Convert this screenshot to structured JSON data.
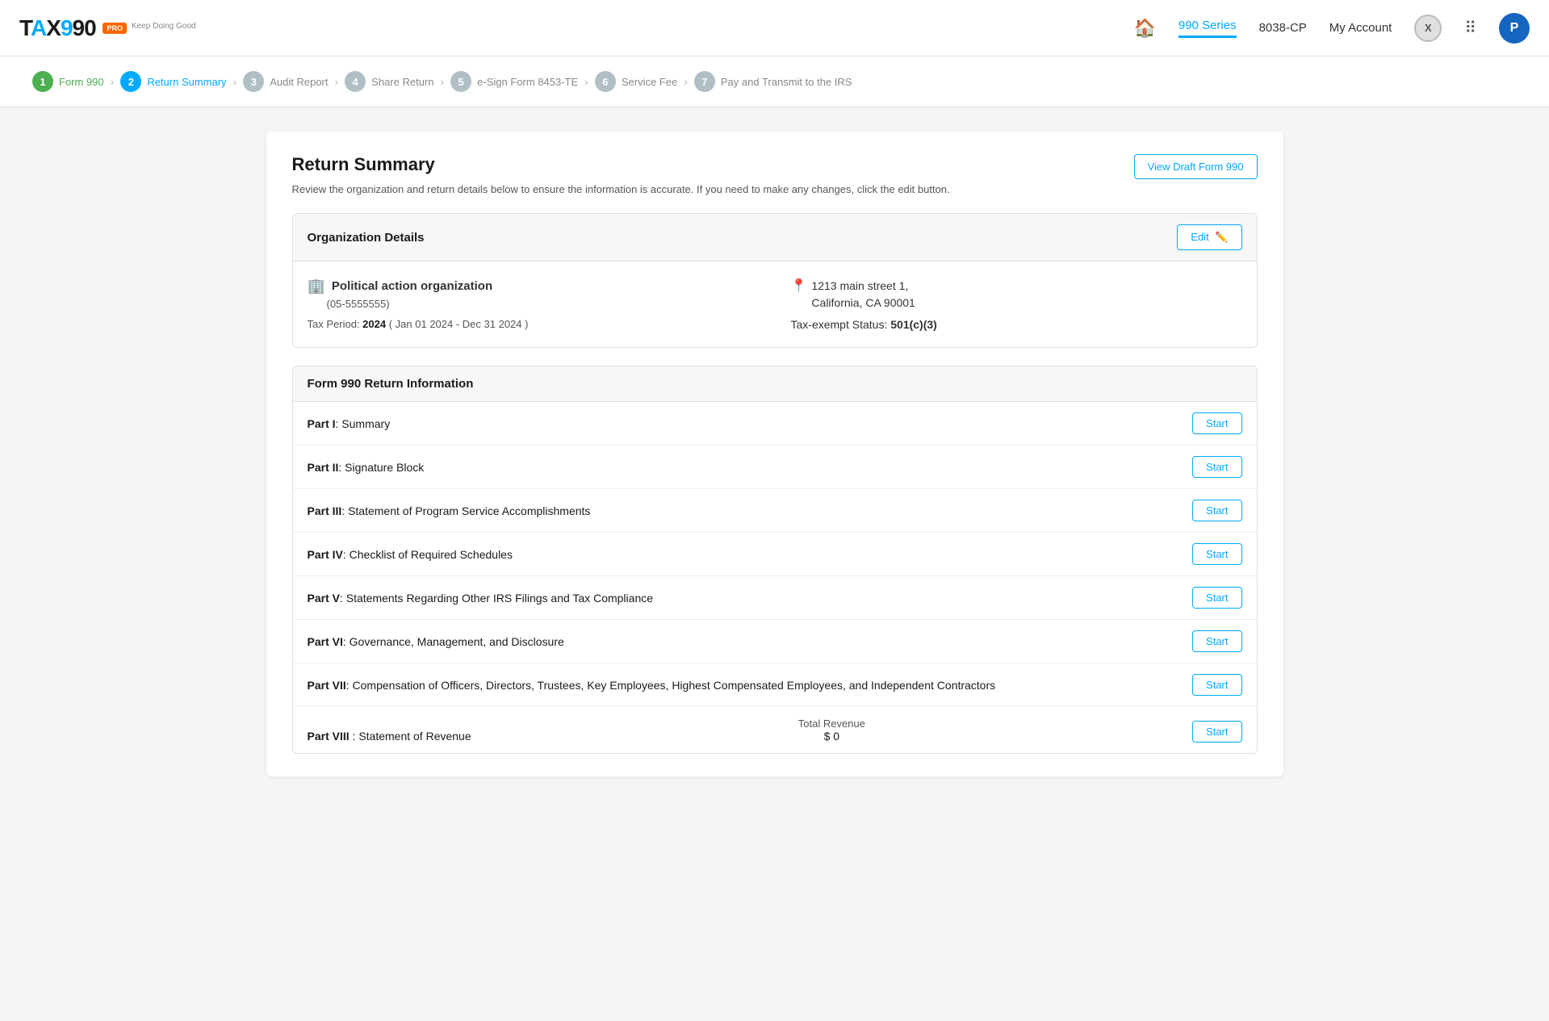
{
  "header": {
    "logo": {
      "tax": "TAX",
      "nine_nine": "990",
      "pro": "PRO",
      "tagline": "Keep Doing Good"
    },
    "nav": {
      "home_icon": "🏠",
      "series_label": "990 Series",
      "form_label": "8038-CP",
      "account_label": "My Account",
      "x_label": "X",
      "grid_icon": "⠿",
      "avatar_label": "P"
    }
  },
  "stepper": {
    "steps": [
      {
        "number": "1",
        "label": "Form 990",
        "state": "active"
      },
      {
        "number": "2",
        "label": "Return Summary",
        "state": "current"
      },
      {
        "number": "3",
        "label": "Audit Report",
        "state": "inactive"
      },
      {
        "number": "4",
        "label": "Share Return",
        "state": "inactive"
      },
      {
        "number": "5",
        "label": "e-Sign Form 8453-TE",
        "state": "inactive"
      },
      {
        "number": "6",
        "label": "Service Fee",
        "state": "inactive"
      },
      {
        "number": "7",
        "label": "Pay and Transmit to the IRS",
        "state": "inactive"
      }
    ]
  },
  "page": {
    "title": "Return Summary",
    "subtitle": "Review the organization and return details below to ensure the information is accurate. If you need to make any changes, click the edit button.",
    "view_draft_btn": "View Draft Form 990"
  },
  "org_section": {
    "title": "Organization Details",
    "edit_btn": "Edit",
    "building_icon": "🏢",
    "location_icon": "📍",
    "org_name": "Political action organization",
    "org_ein": "(05-5555555)",
    "tax_period_label": "Tax Period:",
    "tax_period_value": "2024",
    "tax_period_range": "Jan 01 2024 - Dec 31 2024",
    "address_line1": "1213 main street 1,",
    "address_line2": "California, CA 90001",
    "tax_exempt_label": "Tax-exempt Status:",
    "tax_exempt_value": "501(c)(3)"
  },
  "form990_section": {
    "title": "Form 990 Return Information",
    "parts": [
      {
        "id": "part-i",
        "label": "Part I",
        "name": "Summary",
        "btn": "Start"
      },
      {
        "id": "part-ii",
        "label": "Part II",
        "name": "Signature Block",
        "btn": "Start"
      },
      {
        "id": "part-iii",
        "label": "Part III",
        "name": "Statement of Program Service Accomplishments",
        "btn": "Start"
      },
      {
        "id": "part-iv",
        "label": "Part IV",
        "name": "Checklist of Required Schedules",
        "btn": "Start"
      },
      {
        "id": "part-v",
        "label": "Part V",
        "name": "Statements Regarding Other IRS Filings and Tax Compliance",
        "btn": "Start"
      },
      {
        "id": "part-vi",
        "label": "Part VI",
        "name": "Governance, Management, and Disclosure",
        "btn": "Start"
      },
      {
        "id": "part-vii",
        "label": "Part VII",
        "name": "Compensation of Officers, Directors, Trustees, Key Employees, Highest Compensated Employees, and Independent Contractors",
        "btn": "Start"
      }
    ],
    "part_viii": {
      "label": "Part VIII",
      "name": "Statement of Revenue",
      "revenue_label": "Total Revenue",
      "revenue_amount": "$ 0",
      "btn": "Start"
    }
  }
}
